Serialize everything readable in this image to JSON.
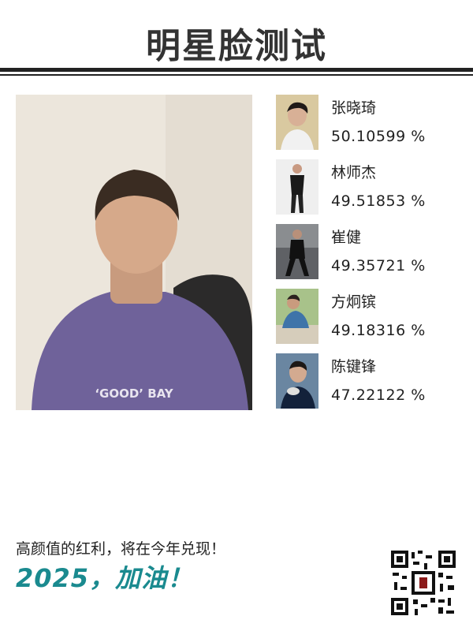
{
  "header": {
    "title": "明星脸测试"
  },
  "photo": {
    "shirt_text": "‘GOOD’ BAY"
  },
  "results": [
    {
      "name": "张晓琦",
      "score": "50.10599 %",
      "icon": "celebrity-portrait"
    },
    {
      "name": "林师杰",
      "score": "49.51853 %",
      "icon": "celebrity-portrait"
    },
    {
      "name": "崔健",
      "score": "49.35721 %",
      "icon": "celebrity-portrait"
    },
    {
      "name": "方炯镔",
      "score": "49.18316 %",
      "icon": "celebrity-portrait"
    },
    {
      "name": "陈键锋",
      "score": "47.22122 %",
      "icon": "celebrity-portrait"
    }
  ],
  "footer": {
    "line1": "高颜值的红利，将在今年兑现！",
    "line2": "2025，加油！"
  },
  "colors": {
    "accent": "#1a8a8f",
    "text": "#222222",
    "rule": "#222222"
  }
}
